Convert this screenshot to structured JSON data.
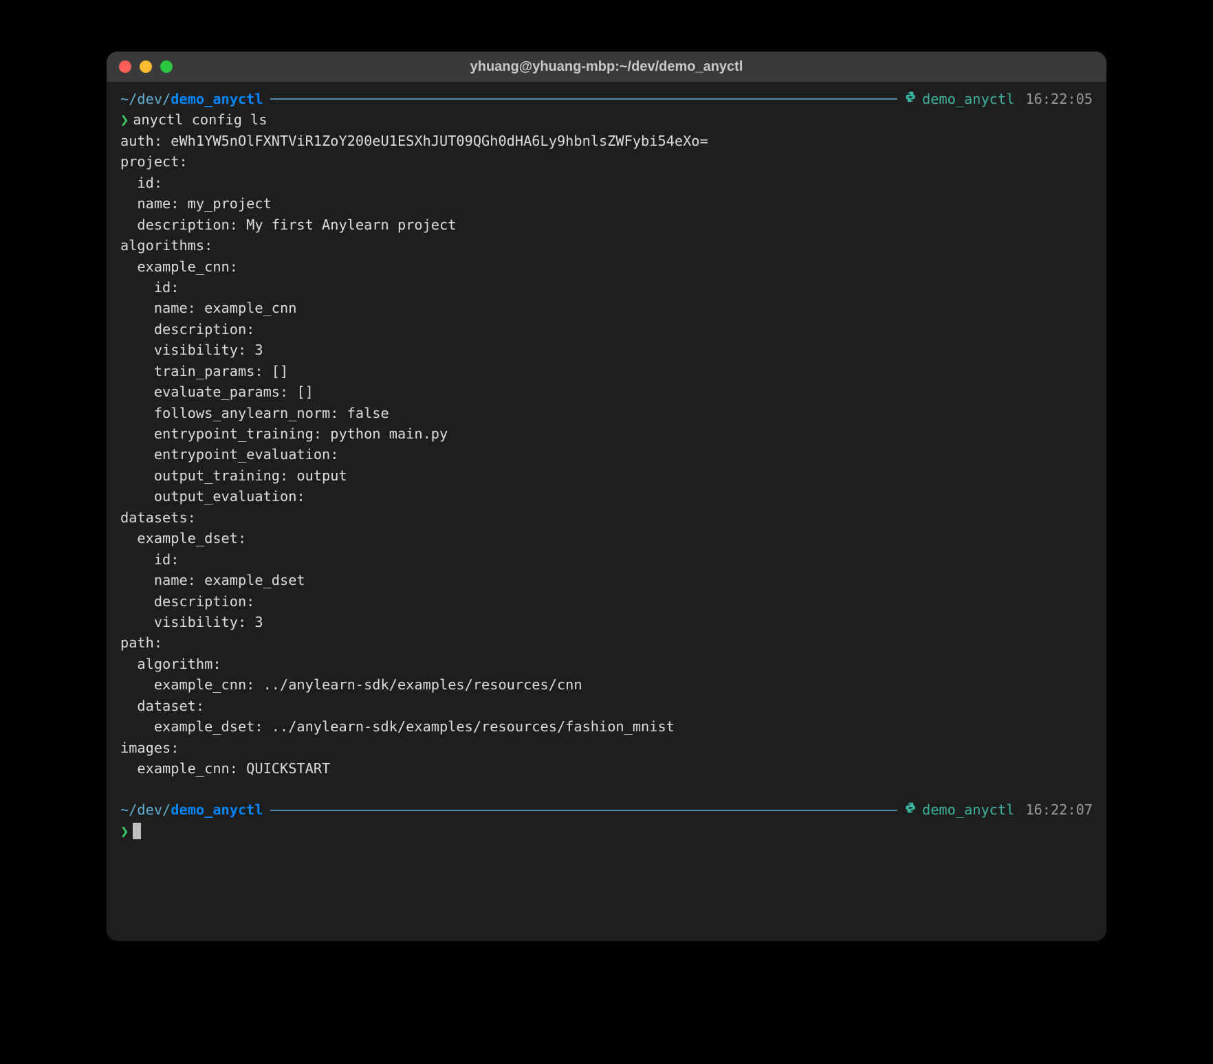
{
  "titlebar": {
    "title": "yhuang@yhuang-mbp:~/dev/demo_anyctl"
  },
  "prompt1": {
    "tilde": "~",
    "path1": "/dev/",
    "current": "demo_anyctl",
    "env": "demo_anyctl",
    "time": "16:22:05"
  },
  "command1": {
    "arrow": "❯",
    "text": "anyctl config ls"
  },
  "output": "auth: eWh1YW5nOlFXNTViR1ZoY200eU1ESXhJUT09QGh0dHA6Ly9hbnlsZWFybi54eXo=\nproject:\n  id:\n  name: my_project\n  description: My first Anylearn project\nalgorithms:\n  example_cnn:\n    id:\n    name: example_cnn\n    description:\n    visibility: 3\n    train_params: []\n    evaluate_params: []\n    follows_anylearn_norm: false\n    entrypoint_training: python main.py\n    entrypoint_evaluation:\n    output_training: output\n    output_evaluation:\ndatasets:\n  example_dset:\n    id:\n    name: example_dset\n    description:\n    visibility: 3\npath:\n  algorithm:\n    example_cnn: ../anylearn-sdk/examples/resources/cnn\n  dataset:\n    example_dset: ../anylearn-sdk/examples/resources/fashion_mnist\nimages:\n  example_cnn: QUICKSTART",
  "prompt2": {
    "tilde": "~",
    "path1": "/dev/",
    "current": "demo_anyctl",
    "env": "demo_anyctl",
    "time": "16:22:07"
  },
  "command2": {
    "arrow": "❯"
  }
}
